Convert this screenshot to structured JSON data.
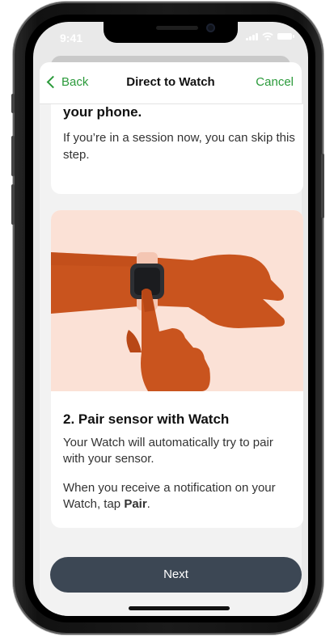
{
  "status_bar": {
    "time": "9:41"
  },
  "nav": {
    "back_label": "Back",
    "title": "Direct to Watch",
    "cancel_label": "Cancel"
  },
  "step1": {
    "title": "your phone.",
    "body": "If you’re in a session now, you can skip this step."
  },
  "step2": {
    "title": "2. Pair sensor with Watch",
    "body": "Your Watch will automatically try to pair with your sensor.",
    "body2_prefix": "When you receive a notification on your Watch, tap ",
    "body2_bold": "Pair",
    "body2_suffix": "."
  },
  "next_button": {
    "label": "Next"
  },
  "colors": {
    "accent": "#2a9a3a",
    "button": "#3c4754",
    "illustration_bg": "#fbe1d6",
    "skin": "#c9541e"
  }
}
